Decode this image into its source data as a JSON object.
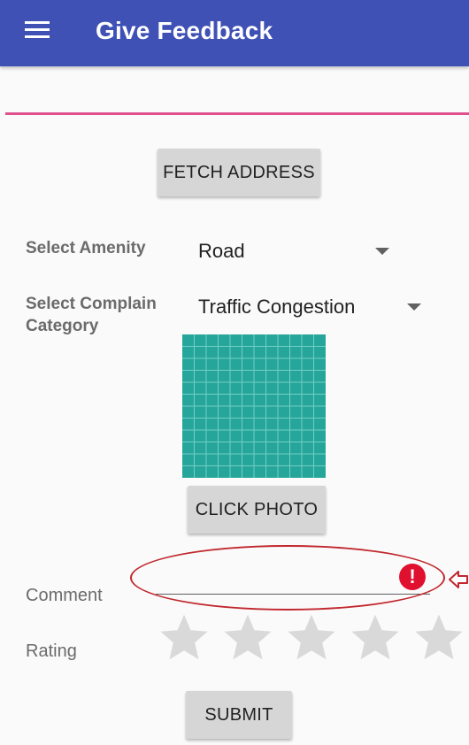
{
  "app_bar": {
    "title": "Give Feedback",
    "menu_icon": "hamburger-menu-icon",
    "background": "#3f51b5"
  },
  "address": {
    "value": "",
    "underline_color": "#e0508f"
  },
  "buttons": {
    "fetch_address": "FETCH ADDRESS",
    "click_photo": "CLICK PHOTO",
    "submit": "SUBMIT"
  },
  "amenity": {
    "label": "Select Amenity",
    "selected": "Road"
  },
  "complain_category": {
    "label": "Select Complain Category",
    "selected": "Traffic Congestion"
  },
  "photo": {
    "icon": "photo-placeholder-grid",
    "color": "#26a69a"
  },
  "comment": {
    "label": "Comment",
    "value": "",
    "error_icon": "error-icon",
    "error_glyph": "!",
    "error_color": "#e0102f"
  },
  "rating": {
    "label": "Rating",
    "value": 0,
    "max": 5,
    "star_icon": "star-icon"
  },
  "annotation": {
    "color": "#c1272d"
  }
}
